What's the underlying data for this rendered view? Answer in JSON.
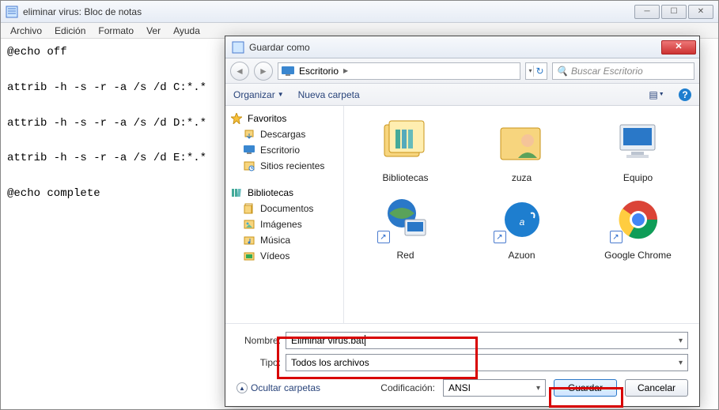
{
  "notepad": {
    "title": "eliminar virus: Bloc de notas",
    "menu": [
      "Archivo",
      "Edición",
      "Formato",
      "Ver",
      "Ayuda"
    ],
    "content": "@echo off\n\nattrib -h -s -r -a /s /d C:*.*\n\nattrib -h -s -r -a /s /d D:*.*\n\nattrib -h -s -r -a /s /d E:*.*\n\n@echo complete"
  },
  "dialog": {
    "title": "Guardar como",
    "path": "Escritorio",
    "search_placeholder": "Buscar Escritorio",
    "toolbar": {
      "organize": "Organizar",
      "newfolder": "Nueva carpeta"
    },
    "sidebar": {
      "favorites": {
        "label": "Favoritos",
        "items": [
          "Descargas",
          "Escritorio",
          "Sitios recientes"
        ]
      },
      "libraries": {
        "label": "Bibliotecas",
        "items": [
          "Documentos",
          "Imágenes",
          "Música",
          "Vídeos"
        ]
      }
    },
    "files": [
      "Bibliotecas",
      "zuza",
      "Equipo",
      "Red",
      "Azuon",
      "Google Chrome"
    ],
    "form": {
      "name_label": "Nombre:",
      "name_value": "Eliminar virus.bat",
      "type_label": "Tipo:",
      "type_value": "Todos los archivos"
    },
    "footer": {
      "hide": "Ocultar carpetas",
      "encoding_label": "Codificación:",
      "encoding_value": "ANSI",
      "save": "Guardar",
      "cancel": "Cancelar"
    }
  }
}
